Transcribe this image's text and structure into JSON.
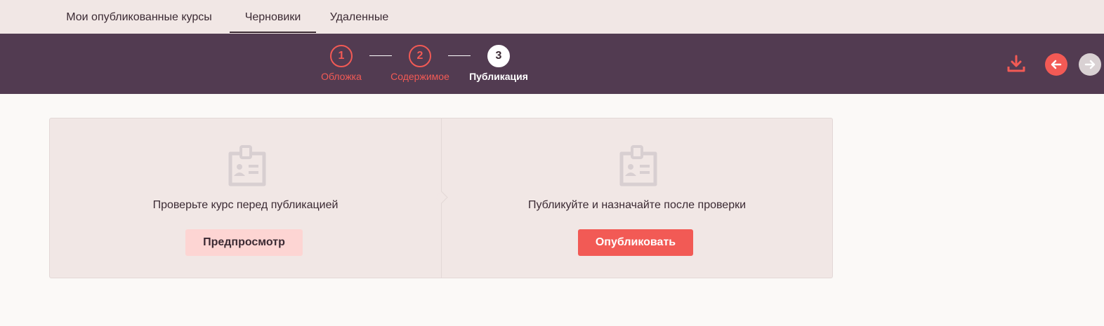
{
  "tabs": {
    "published": "Мои опубликованные курсы",
    "drafts": "Черновики",
    "deleted": "Удаленные",
    "active": "drafts"
  },
  "stepper": {
    "steps": [
      {
        "number": "1",
        "label": "Обложка",
        "state": "done"
      },
      {
        "number": "2",
        "label": "Содержимое",
        "state": "done"
      },
      {
        "number": "3",
        "label": "Публикация",
        "state": "current"
      }
    ]
  },
  "toolbar": {
    "download_icon": "download-icon",
    "back_icon": "arrow-left-icon",
    "forward_icon": "arrow-right-icon"
  },
  "panels": {
    "left": {
      "icon": "id-badge-icon",
      "text": "Проверьте курс перед публикацией",
      "button_label": "Предпросмотр"
    },
    "right": {
      "icon": "id-badge-icon",
      "text": "Публикуйте и назначайте после проверки",
      "button_label": "Опубликовать"
    }
  },
  "colors": {
    "accent": "#f25a55",
    "header_bg": "#523b51",
    "tabs_bg": "#f1e7e5",
    "page_bg": "#fbf9f7"
  }
}
